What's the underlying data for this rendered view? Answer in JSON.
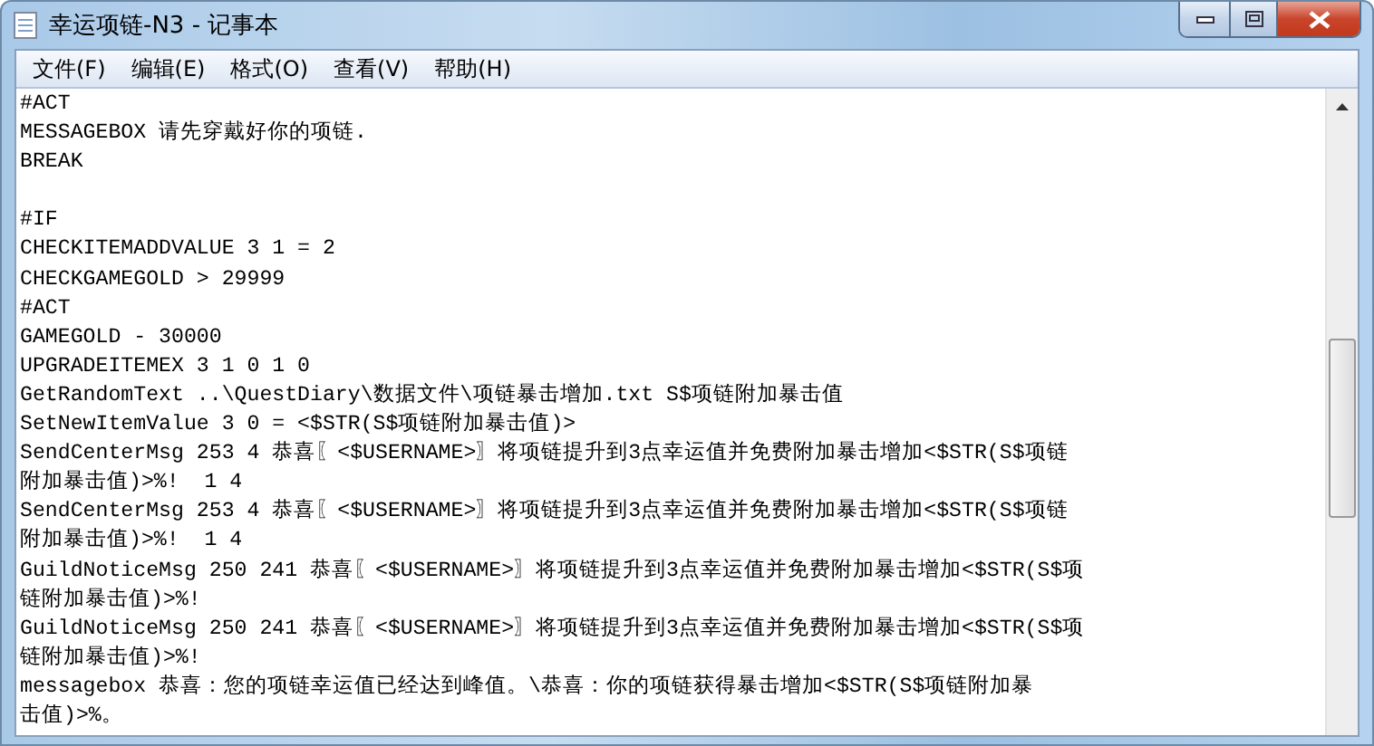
{
  "window": {
    "title": "幸运项链-N3 - 记事本"
  },
  "menu": [
    {
      "label": "文件(F)"
    },
    {
      "label": "编辑(E)"
    },
    {
      "label": "格式(O)"
    },
    {
      "label": "查看(V)"
    },
    {
      "label": "帮助(H)"
    }
  ],
  "editor": {
    "blocks": [
      [
        "#ACT",
        "MESSAGEBOX 请先穿戴好你的项链.",
        "BREAK"
      ],
      [
        "#IF",
        "CHECKITEMADDVALUE 3 1 = 2",
        "CHECKGAMEGOLD > 29999",
        "#ACT",
        "GAMEGOLD - 30000",
        "UPGRADEITEMEX 3 1 0 1 0",
        "GetRandomText ..\\QuestDiary\\数据文件\\项链暴击增加.txt S$项链附加暴击值",
        "SetNewItemValue 3 0 = <$STR(S$项链附加暴击值)>",
        "SendCenterMsg 253 4 恭喜〖<$USERNAME>〗将项链提升到3点幸运值并免费附加暴击增加<$STR(S$项链",
        "附加暴击值)>%!  1 4",
        "SendCenterMsg 253 4 恭喜〖<$USERNAME>〗将项链提升到3点幸运值并免费附加暴击增加<$STR(S$项链",
        "附加暴击值)>%!  1 4",
        "GuildNoticeMsg 250 241 恭喜〖<$USERNAME>〗将项链提升到3点幸运值并免费附加暴击增加<$STR(S$项",
        "链附加暴击值)>%!",
        "GuildNoticeMsg 250 241 恭喜〖<$USERNAME>〗将项链提升到3点幸运值并免费附加暴击增加<$STR(S$项",
        "链附加暴击值)>%!",
        "messagebox 恭喜：您的项链幸运值已经达到峰值。\\恭喜：你的项链获得暴击增加<$STR(S$项链附加暴",
        "击值)>%。"
      ]
    ]
  }
}
